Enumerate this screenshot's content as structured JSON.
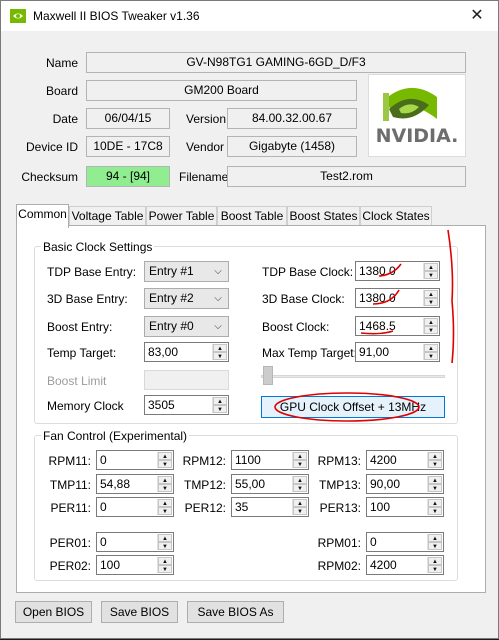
{
  "window": {
    "title": "Maxwell II BIOS Tweaker v1.36",
    "close_glyph": "✕"
  },
  "info": {
    "name_label": "Name",
    "name_value": "GV-N98TG1 GAMING-6GD_D/F3",
    "board_label": "Board",
    "board_value": "GM200 Board",
    "date_label": "Date",
    "date_value": "06/04/15",
    "version_label": "Version",
    "version_value": "84.00.32.00.67",
    "device_label": "Device ID",
    "device_value": "10DE - 17C8",
    "vendor_label": "Vendor",
    "vendor_value": "Gigabyte (1458)",
    "checksum_label": "Checksum",
    "checksum_value": "94 - [94]",
    "filename_label": "Filename",
    "filename_value": "Test2.rom",
    "logo_text": "NVIDIA.",
    "checksum_color": "#90ee90"
  },
  "tabs": [
    "Common",
    "Voltage Table",
    "Power Table",
    "Boost Table",
    "Boost States",
    "Clock States"
  ],
  "active_tab": "Common",
  "clock": {
    "title": "Basic Clock Settings",
    "tdp_entry_label": "TDP Base Entry:",
    "tdp_entry_value": "Entry #1",
    "d3_entry_label": "3D Base Entry:",
    "d3_entry_value": "Entry #2",
    "boost_entry_label": "Boost Entry:",
    "boost_entry_value": "Entry #0",
    "temp_target_label": "Temp Target:",
    "temp_target_value": "83,00",
    "boost_limit_label": "Boost Limit",
    "memory_clock_label": "Memory Clock",
    "memory_clock_value": "3505",
    "tdp_clock_label": "TDP Base Clock:",
    "tdp_clock_value": "1380.0",
    "d3_clock_label": "3D Base Clock:",
    "d3_clock_value": "1380.0",
    "boost_clock_label": "Boost Clock:",
    "boost_clock_value": "1468.5",
    "max_temp_label": "Max Temp Target:",
    "max_temp_value": "91,00",
    "gpu_offset_button": "GPU Clock Offset + 13MHz"
  },
  "fan": {
    "title": "Fan Control (Experimental)",
    "rpm11_label": "RPM11:",
    "rpm11_value": "0",
    "tmp11_label": "TMP11:",
    "tmp11_value": "54,88",
    "per11_label": "PER11:",
    "per11_value": "0",
    "rpm12_label": "RPM12:",
    "rpm12_value": "1100",
    "tmp12_label": "TMP12:",
    "tmp12_value": "55,00",
    "per12_label": "PER12:",
    "per12_value": "35",
    "rpm13_label": "RPM13:",
    "rpm13_value": "4200",
    "tmp13_label": "TMP13:",
    "tmp13_value": "90,00",
    "per13_label": "PER13:",
    "per13_value": "100",
    "per01_label": "PER01:",
    "per01_value": "0",
    "per02_label": "PER02:",
    "per02_value": "100",
    "rpm01_label": "RPM01:",
    "rpm01_value": "0",
    "rpm02_label": "RPM02:",
    "rpm02_value": "4200"
  },
  "buttons": {
    "open": "Open BIOS",
    "save": "Save BIOS",
    "save_as": "Save BIOS As"
  },
  "annotation_color": "#e00000"
}
